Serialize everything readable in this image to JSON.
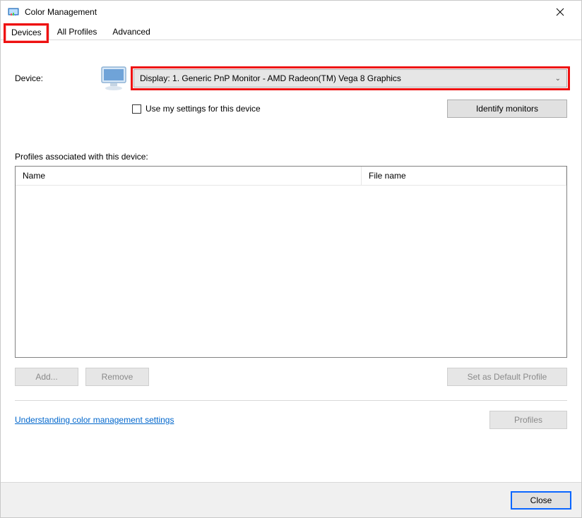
{
  "window": {
    "title": "Color Management"
  },
  "tabs": {
    "devices": "Devices",
    "all_profiles": "All Profiles",
    "advanced": "Advanced"
  },
  "device": {
    "label": "Device:",
    "selected": "Display: 1. Generic PnP Monitor - AMD Radeon(TM) Vega 8 Graphics",
    "use_settings_label": "Use my settings for this device",
    "identify_btn": "Identify monitors"
  },
  "profiles": {
    "section_label": "Profiles associated with this device:",
    "col_name": "Name",
    "col_file": "File name",
    "add_btn": "Add...",
    "remove_btn": "Remove",
    "default_btn": "Set as Default Profile"
  },
  "bottom": {
    "link": "Understanding color management settings",
    "profiles_btn": "Profiles"
  },
  "footer": {
    "close_btn": "Close"
  }
}
